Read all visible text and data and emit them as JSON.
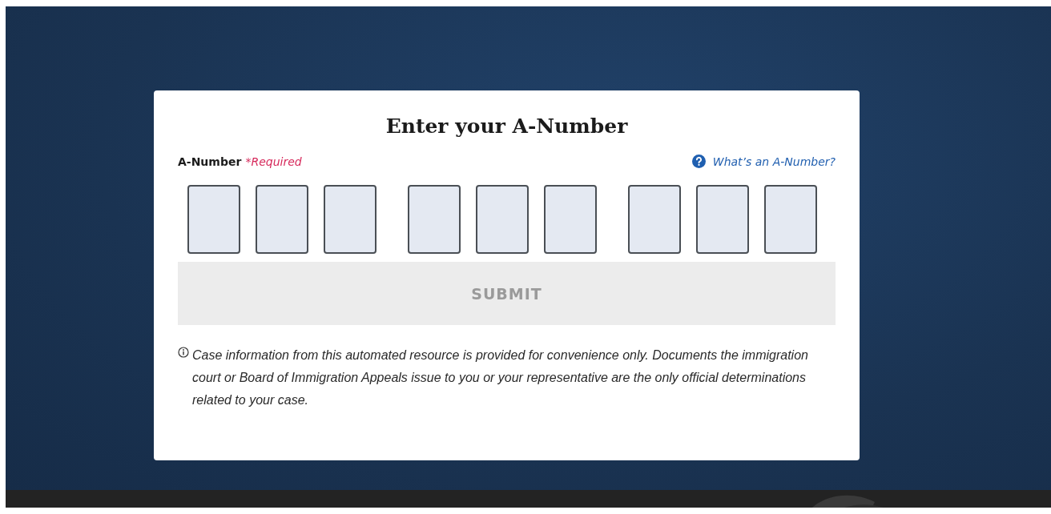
{
  "card": {
    "title": "Enter your A-Number",
    "field_label": "A-Number",
    "required_text": "*Required",
    "help_link": "What’s an A-Number?",
    "digit_inputs": [
      {
        "kind": "digit"
      },
      {
        "kind": "digit"
      },
      {
        "kind": "digit"
      },
      {
        "kind": "gap"
      },
      {
        "kind": "digit"
      },
      {
        "kind": "digit"
      },
      {
        "kind": "digit"
      },
      {
        "kind": "gap"
      },
      {
        "kind": "digit"
      },
      {
        "kind": "digit"
      },
      {
        "kind": "digit"
      }
    ],
    "submit": {
      "label": "SUBMIT",
      "disabled": true
    },
    "notice": "Case information from this automated resource is provided for convenience only. Documents the immigration court or Board of Immigration Appeals issue to you or your representative are the only official determinations related to your case."
  }
}
